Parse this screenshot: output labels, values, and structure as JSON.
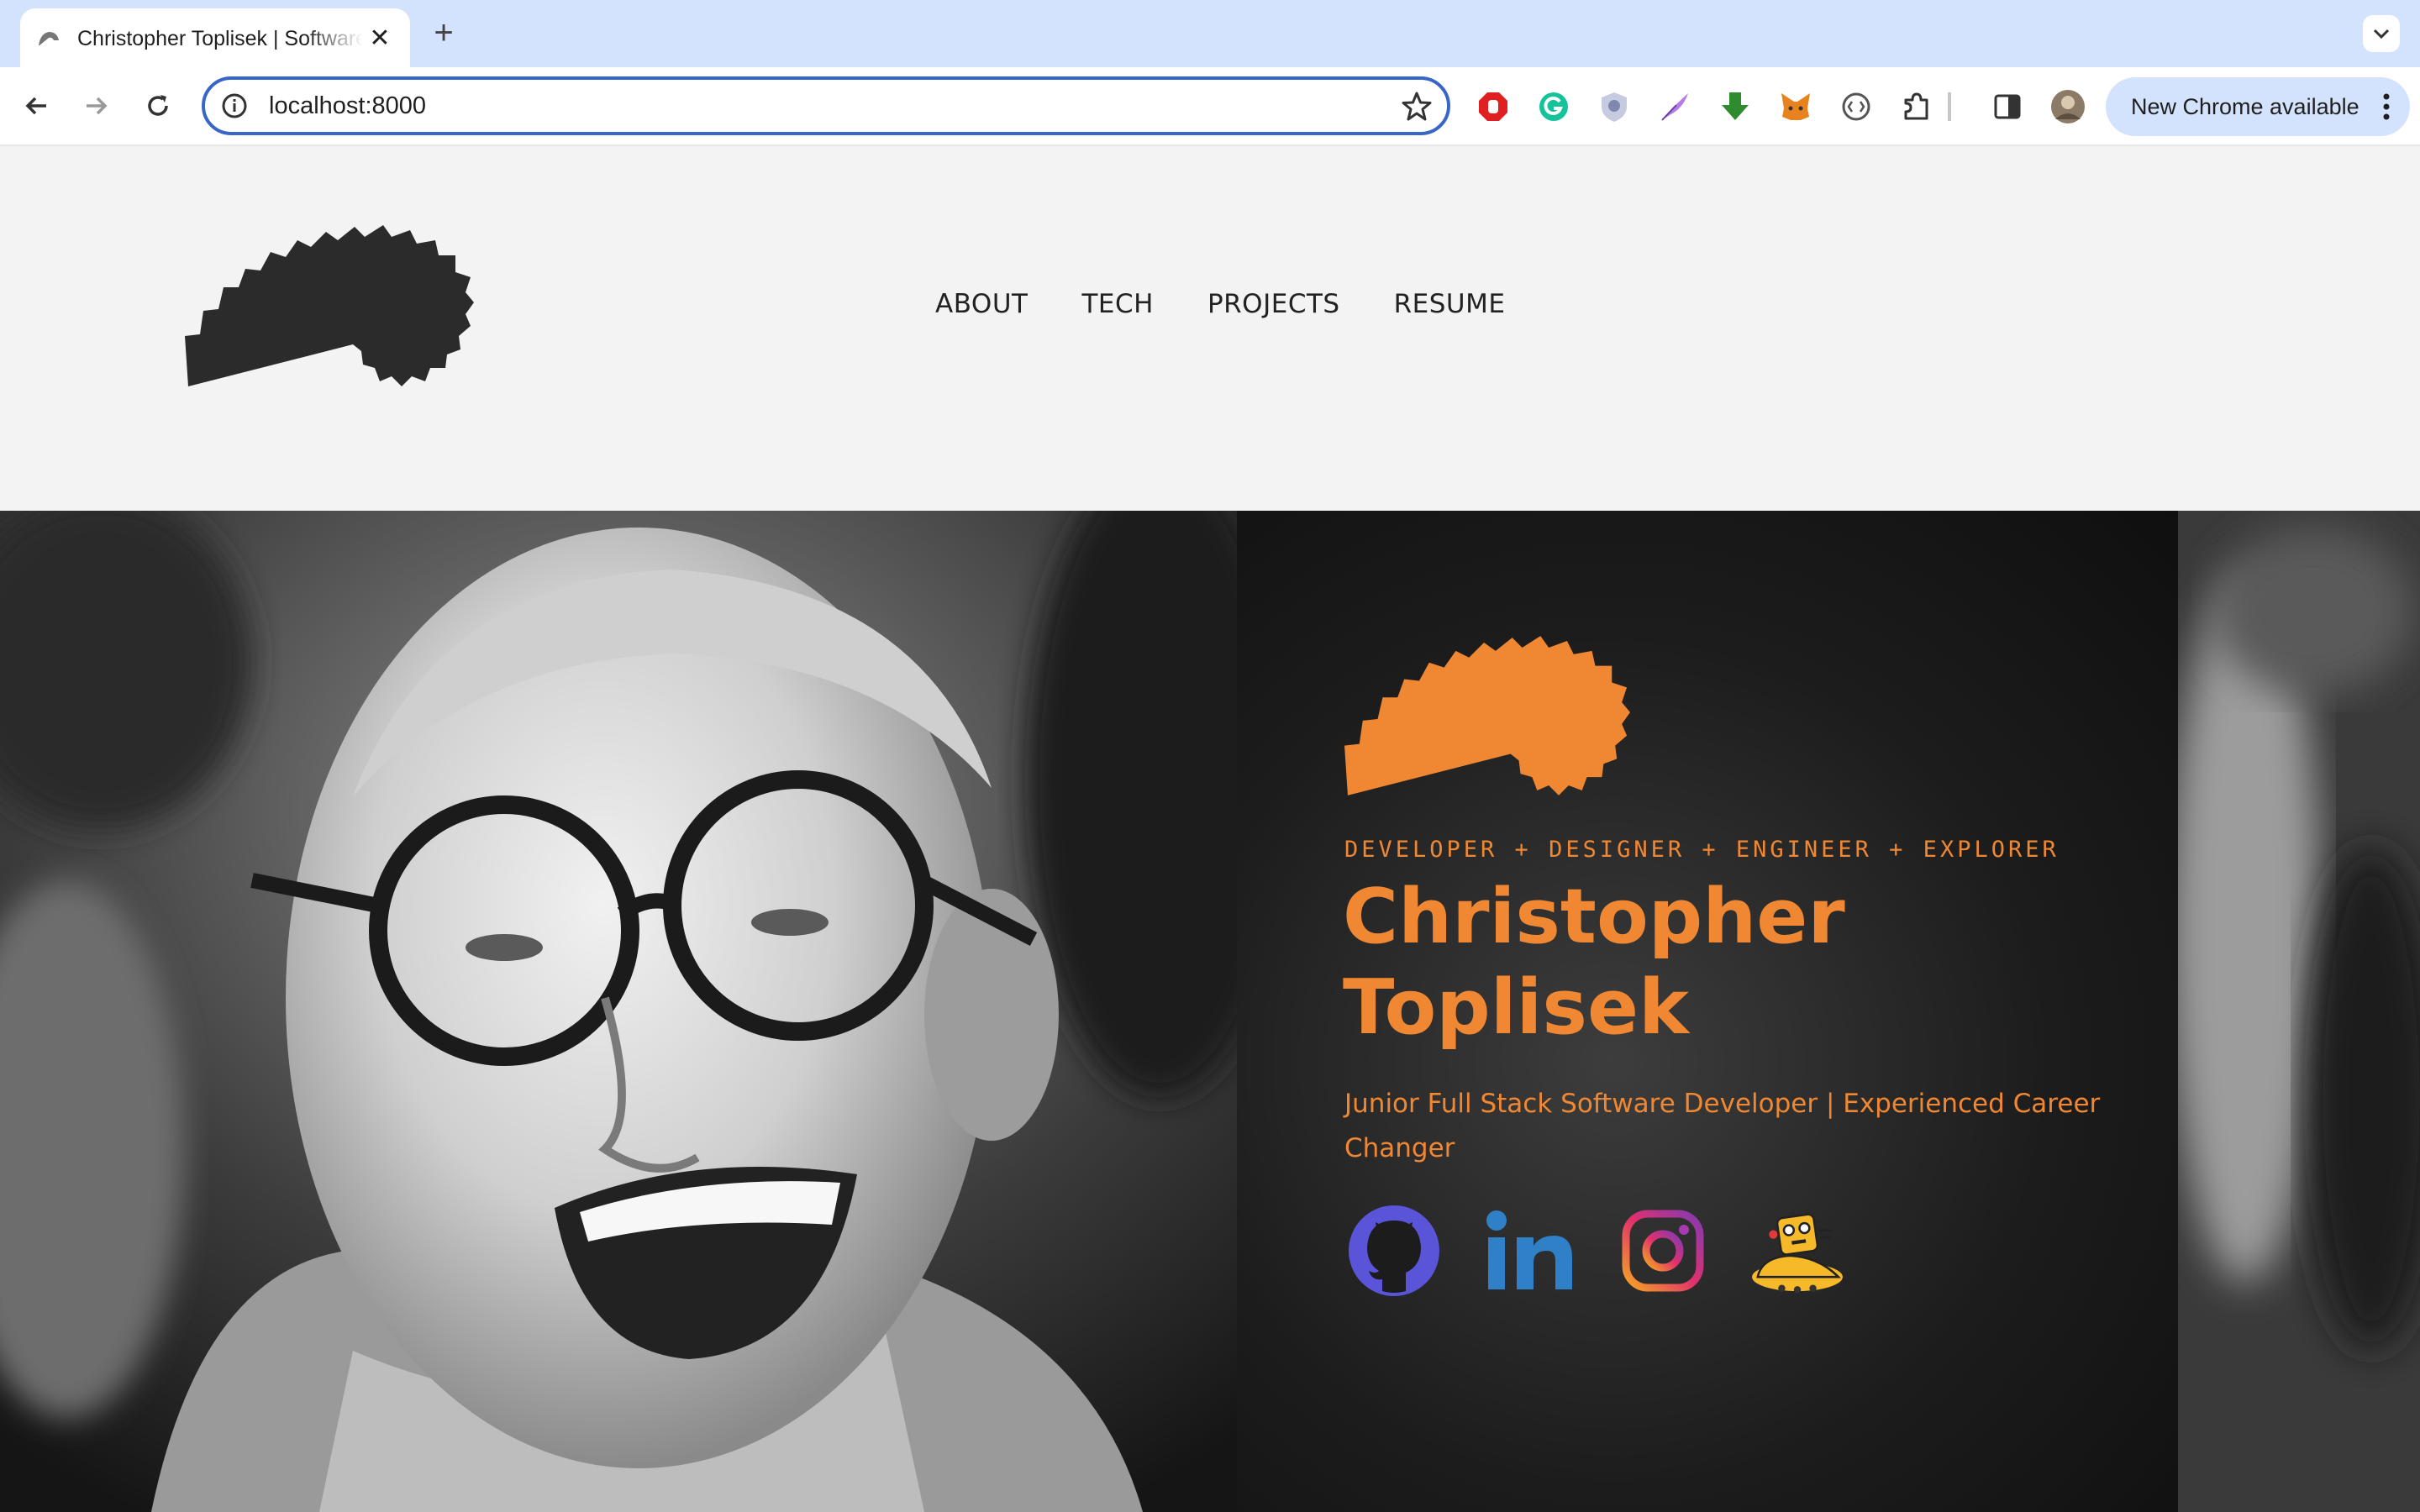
{
  "browser": {
    "tab_title": "Christopher Toplisek | Software Developer",
    "tab_close": "✕",
    "new_tab": "+",
    "url": "localhost:8000",
    "update_button": "New Chrome available",
    "colors": {
      "tabbar": "#d3e3fd",
      "omnibox_border": "#3866c8"
    },
    "icons": [
      "back-icon",
      "forward-icon",
      "reload-icon",
      "site-info-icon",
      "bookmark-star-icon",
      "adblock-icon",
      "grammarly-icon",
      "privacy-badger-icon",
      "quill-icon",
      "download-icon",
      "metamask-icon",
      "devtools-icon",
      "extensions-puzzle-icon",
      "side-panel-icon",
      "profile-avatar",
      "kebab-menu-icon",
      "tab-search-icon"
    ]
  },
  "site": {
    "nav": [
      "ABOUT",
      "TECH",
      "PROJECTS",
      "RESUME"
    ],
    "hero": {
      "tagline": "DEVELOPER + DESIGNER + ENGINEER + EXPLORER",
      "name_first": "Christopher",
      "name_last": "Toplisek",
      "description": "Junior Full Stack Software Developer | Experienced Career Changer",
      "social_icons": [
        "github-icon",
        "linkedin-icon",
        "instagram-icon",
        "robot-mascot-icon"
      ]
    },
    "colors": {
      "accent": "#f08833",
      "dark": "#2b2b2b",
      "page_bg": "#f3f3f3"
    }
  }
}
